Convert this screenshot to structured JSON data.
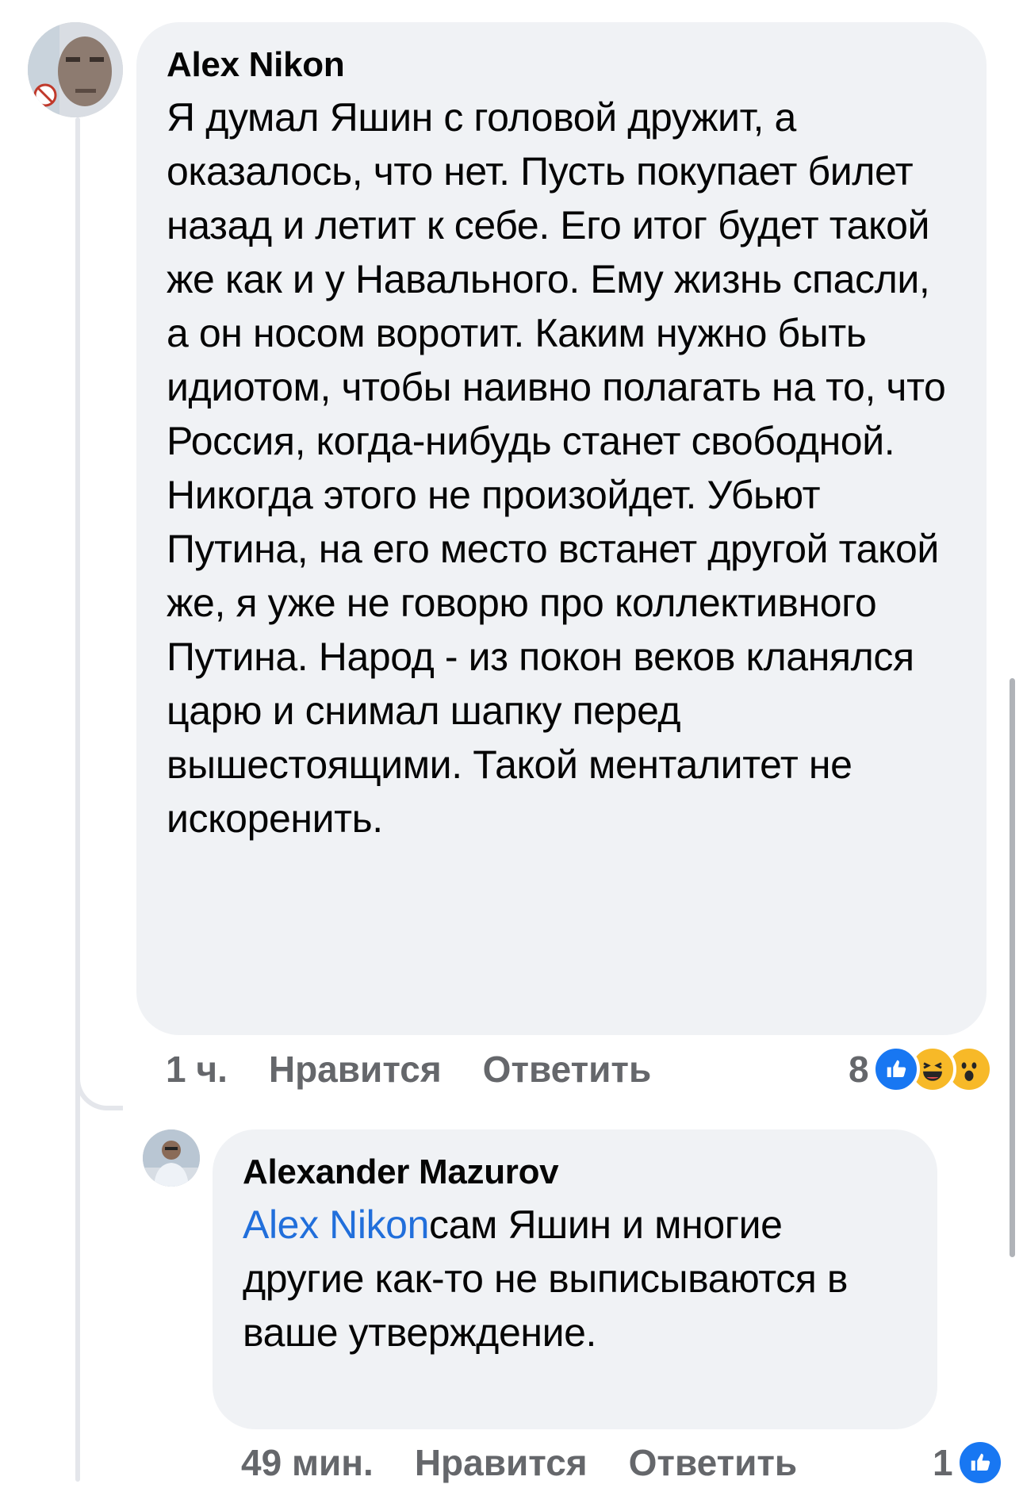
{
  "comments": [
    {
      "author": "Alex Nikon",
      "text": "Я думал Яшин с головой дружит, а оказалось, что нет. Пусть покупает билет назад и летит к себе.  Его итог будет такой же как и у Навального. Ему жизнь спасли, а он носом воротит. Каким нужно быть идиотом, чтобы наивно полагать на то, что Россия, когда-нибудь станет свободной. Никогда этого не произойдет. Убьют Путина, на его место встанет другой такой же, я уже не говорю про коллективного Путина. Народ - из покон веков кланялся царю и снимал шапку перед вышестоящими. Такой менталитет не искоренить.",
      "time": "1 ч.",
      "like_label": "Нравится",
      "reply_label": "Ответить",
      "reaction_count": "8",
      "reactions": [
        "like-icon",
        "haha-icon",
        "wow-icon"
      ]
    },
    {
      "author": "Alexander Mazurov",
      "mention": "Alex Nikon",
      "text": "сам Яшин и многие другие как-то не выписываются в ваше утверждение.",
      "time": "49 мин.",
      "like_label": "Нравится",
      "reply_label": "Ответить",
      "reaction_count": "1",
      "reactions": [
        "like-icon"
      ]
    }
  ],
  "colors": {
    "bubble": "#f0f2f5",
    "mention": "#216fdb",
    "meta": "#65676b",
    "like": "#1877f2",
    "haha": "#f7b928"
  }
}
